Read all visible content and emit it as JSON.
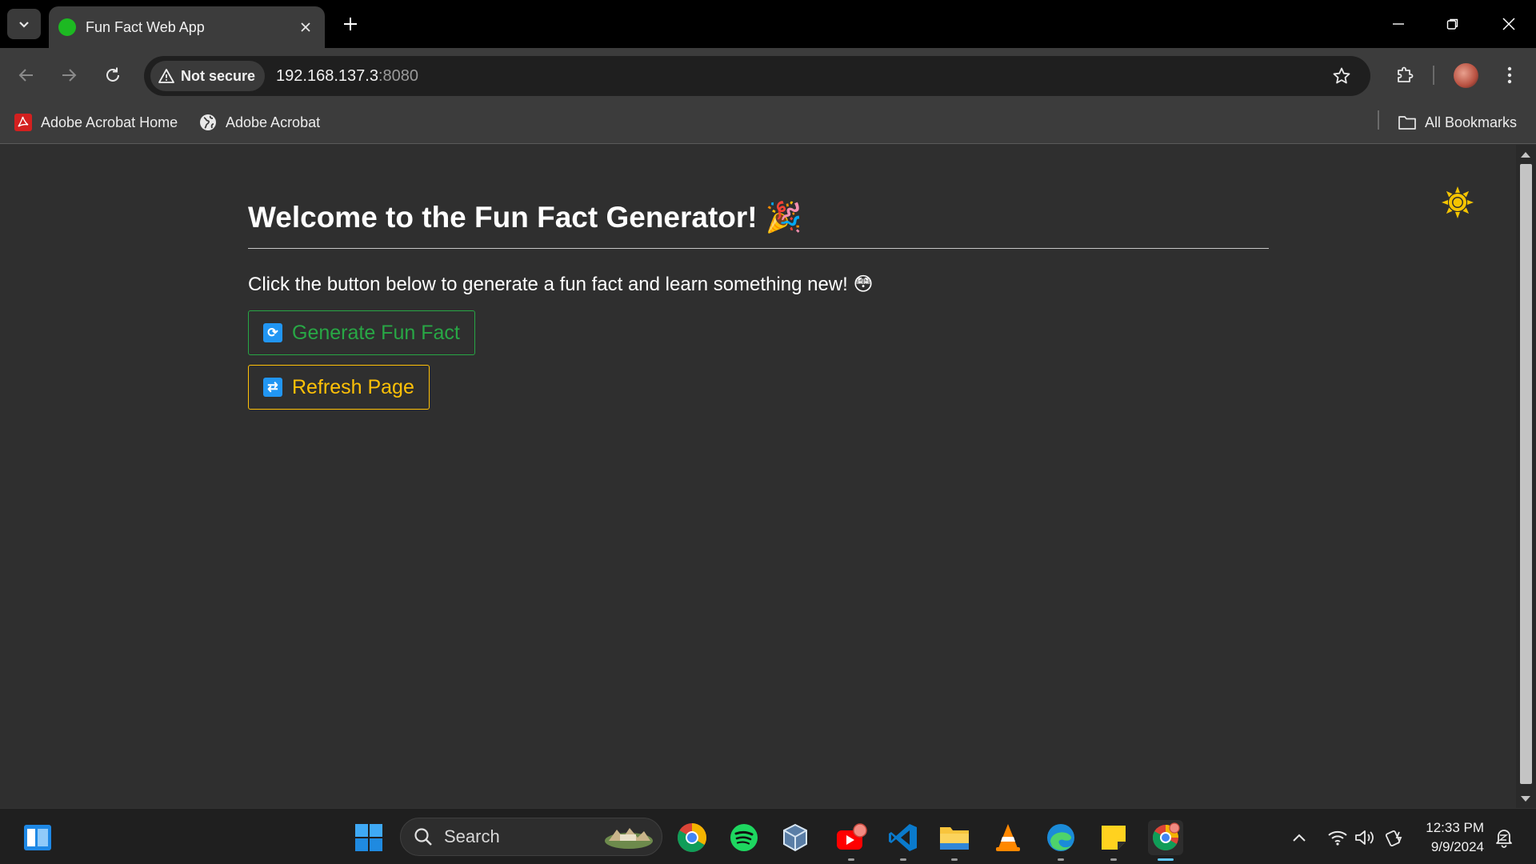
{
  "browser": {
    "tab_title": "Fun Fact Web App",
    "security_label": "Not secure",
    "url_host": "192.168.137.3",
    "url_port": ":8080"
  },
  "bookmarks": {
    "items": [
      {
        "label": "Adobe Acrobat Home",
        "icon": "adobe-acrobat-icon"
      },
      {
        "label": "Adobe Acrobat",
        "icon": "globe-icon"
      }
    ],
    "all_bookmarks_label": "All Bookmarks"
  },
  "page": {
    "title": "Welcome to the Fun Fact Generator! 🎉",
    "subtitle": "Click the button below to generate a fun fact and learn something new! 😳",
    "generate_button": "Generate Fun Fact",
    "refresh_button": "Refresh Page",
    "theme_icon": "sun-icon"
  },
  "colors": {
    "generate_accent": "#28a745",
    "refresh_accent": "#ffc107",
    "theme_icon": "#f5c400",
    "button_icon_bg": "#2196f3"
  },
  "taskbar": {
    "search_label": "Search",
    "time": "12:33 PM",
    "date": "9/9/2024",
    "apps": [
      "widgets-icon",
      "start-icon",
      "chrome-icon",
      "spotify-icon",
      "virtualbox-icon",
      "youtube-icon",
      "vscode-icon",
      "file-explorer-icon",
      "vlc-icon",
      "edge-icon",
      "sticky-notes-icon",
      "chrome-active-icon"
    ]
  }
}
